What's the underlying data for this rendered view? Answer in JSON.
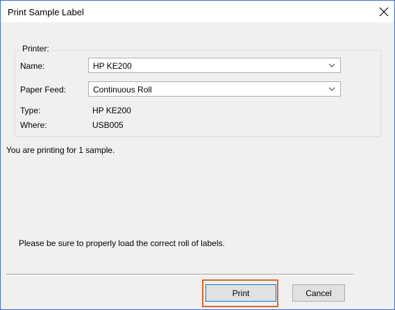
{
  "window": {
    "title": "Print Sample Label",
    "close_glyph": "✕"
  },
  "printer_group": {
    "legend": "Printer:",
    "name_label": "Name:",
    "name_value": "HP KE200",
    "paper_feed_label": "Paper Feed:",
    "paper_feed_value": "Continuous Roll",
    "type_label": "Type:",
    "type_value": "HP KE200",
    "where_label": "Where:",
    "where_value": "USB005"
  },
  "messages": {
    "sample_count": "You are printing for 1 sample.",
    "load_notice": "Please be sure to properly load the correct roll of labels."
  },
  "buttons": {
    "print_label": "Print",
    "cancel_label": "Cancel"
  },
  "colors": {
    "window_border": "#3c6fd0",
    "highlight": "#e0652c",
    "dialog_bg": "#f0f0f0"
  },
  "icons": {
    "close": "close-icon",
    "dropdown": "chevron-down-icon"
  }
}
